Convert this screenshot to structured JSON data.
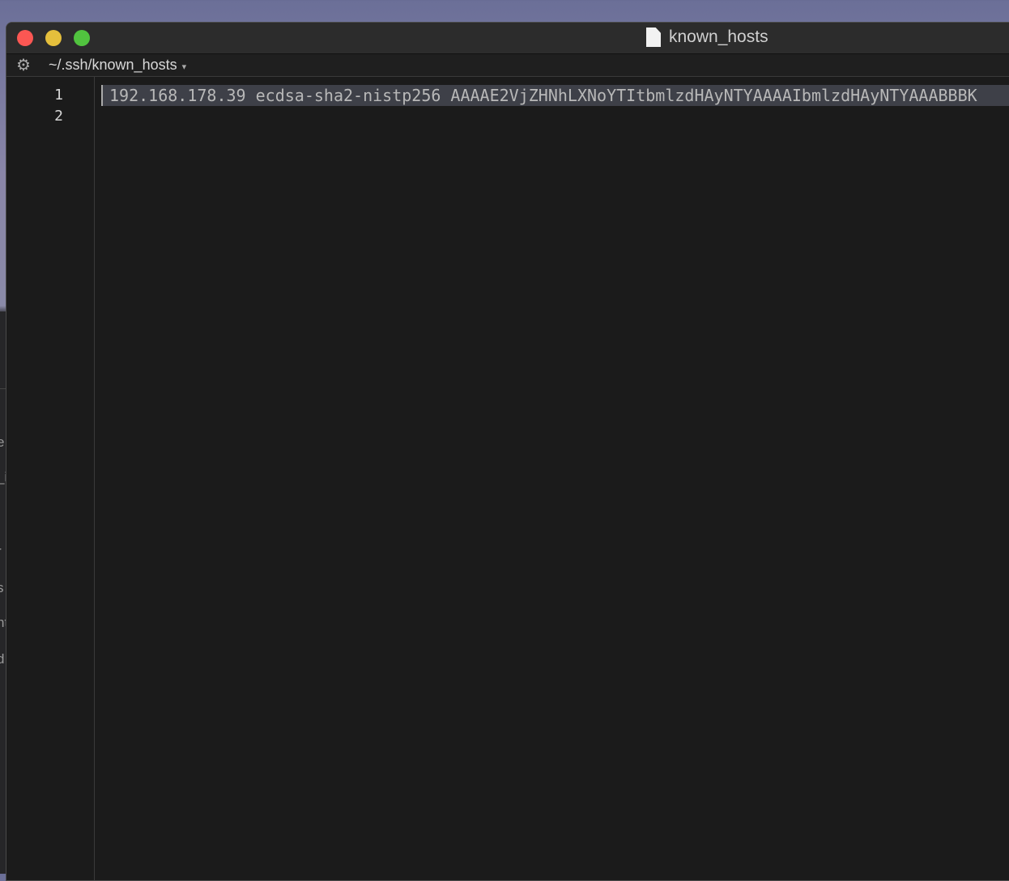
{
  "window": {
    "title": "known_hosts",
    "path": "~/.ssh/known_hosts"
  },
  "editor": {
    "line_numbers": [
      "1",
      "2"
    ],
    "lines": [
      "192.168.178.39 ecdsa-sha2-nistp256 AAAAE2VjZHNhLXNoYTItbmlzdHAyNTYAAAAIbmlzdHAyNTYAAABBBK",
      ""
    ]
  },
  "background_window": {
    "fragments": [
      "e",
      "_i",
      "r",
      "s",
      "nt",
      "d",
      "i"
    ]
  }
}
